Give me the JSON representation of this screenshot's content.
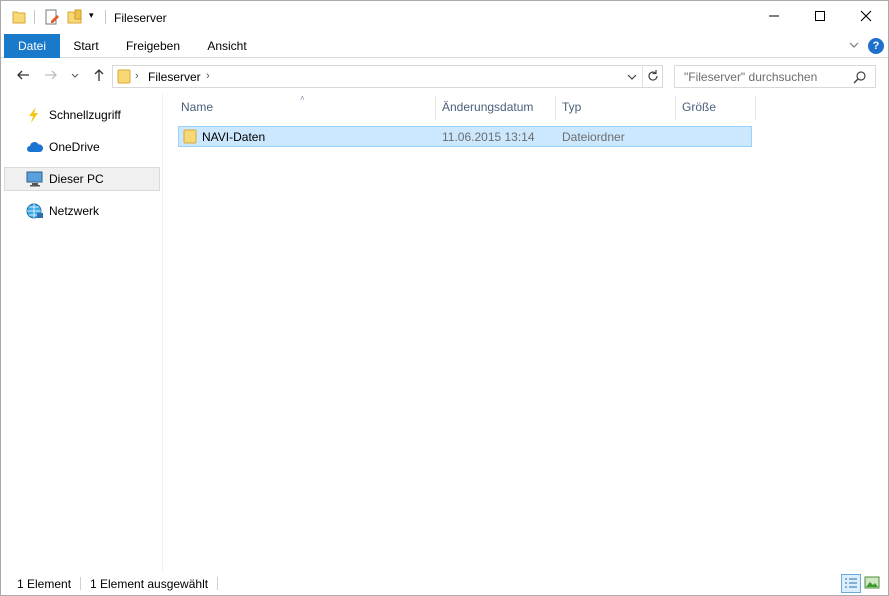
{
  "window": {
    "title": "Fileserver"
  },
  "ribbon": {
    "tabs": [
      "Datei",
      "Start",
      "Freigeben",
      "Ansicht"
    ],
    "help_label": "?"
  },
  "navigation": {
    "breadcrumb": [
      "Fileserver"
    ],
    "search_placeholder": "\"Fileserver\" durchsuchen"
  },
  "sidebar": {
    "items": [
      {
        "label": "Schnellzugriff",
        "icon": "lightning-icon"
      },
      {
        "label": "OneDrive",
        "icon": "cloud-icon"
      },
      {
        "label": "Dieser PC",
        "icon": "computer-icon",
        "selected": true
      },
      {
        "label": "Netzwerk",
        "icon": "network-icon"
      }
    ]
  },
  "table": {
    "columns": [
      "Name",
      "Änderungsdatum",
      "Typ",
      "Größe"
    ],
    "sort_column": "Name",
    "rows": [
      {
        "name": "NAVI-Daten",
        "modified": "11.06.2015 13:14",
        "type": "Dateiordner",
        "size": "",
        "selected": true
      }
    ]
  },
  "status": {
    "count": "1 Element",
    "selected": "1 Element ausgewählt"
  },
  "colors": {
    "accent": "#1979ca",
    "selection_bg": "#cce8ff",
    "selection_border": "#99d1ff",
    "folder_yellow": "#f8d775"
  }
}
